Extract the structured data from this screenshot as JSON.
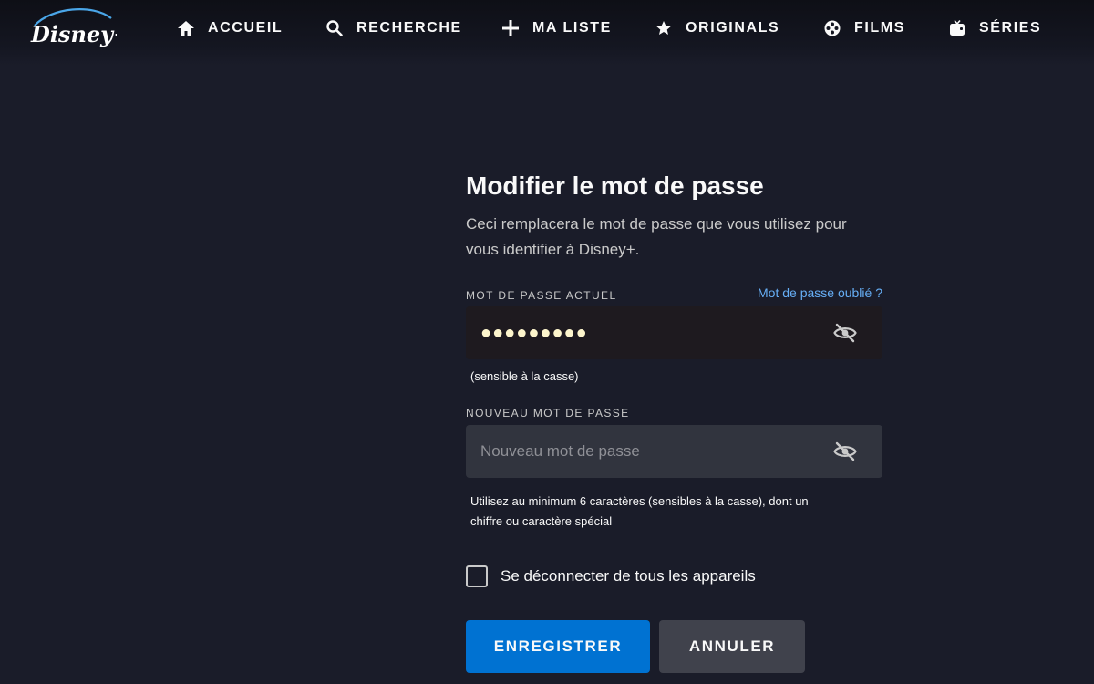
{
  "brand": {
    "logo_text": "Disney+"
  },
  "nav": [
    {
      "label": "ACCUEIL",
      "icon": "home-icon"
    },
    {
      "label": "RECHERCHE",
      "icon": "search-icon"
    },
    {
      "label": "MA LISTE",
      "icon": "plus-icon"
    },
    {
      "label": "ORIGINALS",
      "icon": "star-icon"
    },
    {
      "label": "FILMS",
      "icon": "film-reel-icon"
    },
    {
      "label": "SÉRIES",
      "icon": "tv-icon"
    }
  ],
  "form": {
    "title": "Modifier le mot de passe",
    "subtitle_line1": "Ceci remplacera le mot de passe que vous utilisez pour",
    "subtitle_line2": "vous identifier à Disney+.",
    "current_label": "MOT DE PASSE ACTUEL",
    "forgot_link": "Mot de passe oublié ?",
    "current_value": "●●●●●●●●●",
    "current_hint": "(sensible à la casse)",
    "new_label": "NOUVEAU MOT DE PASSE",
    "new_placeholder": "Nouveau mot de passe",
    "new_hint_line1": "Utilisez au minimum 6 caractères (sensibles à la casse), dont un",
    "new_hint_line2": "chiffre ou caractère spécial",
    "logout_all_label": "Se déconnecter de tous les appareils",
    "logout_all_checked": false,
    "save_button": "ENREGISTRER",
    "cancel_button": "ANNULER"
  },
  "colors": {
    "background": "#1a1c29",
    "primary_button": "#0072d2",
    "secondary_button": "#40424c",
    "link": "#66aef5"
  }
}
